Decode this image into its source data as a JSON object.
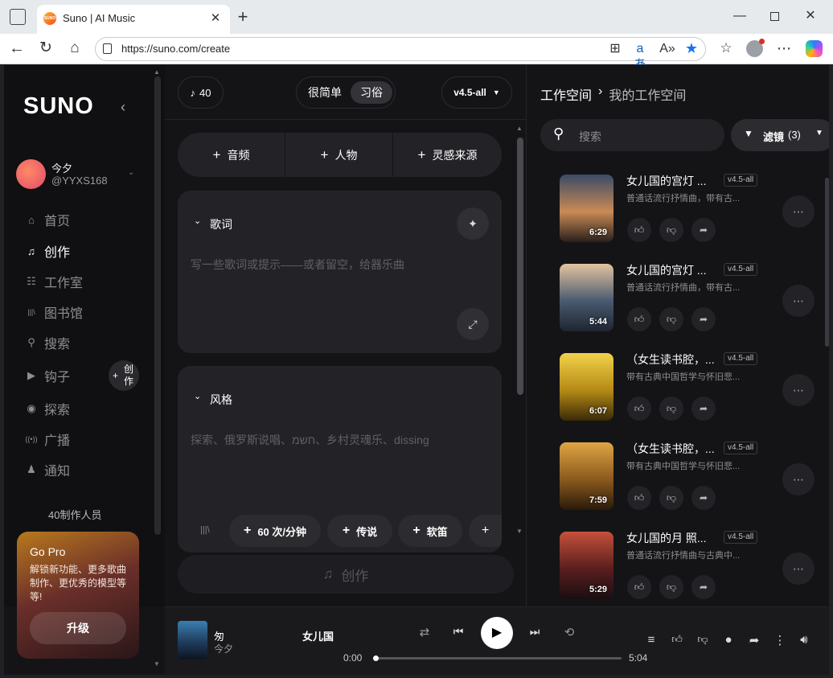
{
  "browser": {
    "tab_title": "Suno | AI Music",
    "favicon_text": "SUNO",
    "url": "https://suno.com/create"
  },
  "sidebar": {
    "logo": "SUNO",
    "user": {
      "name": "今夕",
      "handle": "@YYXS168"
    },
    "items": [
      {
        "label": "首页",
        "icon": "home-icon",
        "glyph": "⌂",
        "active": false
      },
      {
        "label": "创作",
        "icon": "music-note-icon",
        "glyph": "♫",
        "active": true
      },
      {
        "label": "工作室",
        "icon": "studio-icon",
        "glyph": "☷",
        "active": false
      },
      {
        "label": "图书馆",
        "icon": "library-icon",
        "glyph": "|||\\",
        "active": false
      },
      {
        "label": "搜索",
        "icon": "search-icon",
        "glyph": "⚲",
        "active": false
      },
      {
        "label": "钩子",
        "icon": "hook-icon",
        "glyph": "▶",
        "active": false
      },
      {
        "label": "探索",
        "icon": "compass-icon",
        "glyph": "◉",
        "active": false
      },
      {
        "label": "广播",
        "icon": "broadcast-icon",
        "glyph": "((•))",
        "active": false
      },
      {
        "label": "通知",
        "icon": "bell-icon",
        "glyph": "♟",
        "active": false
      }
    ],
    "create_chip": {
      "plus": "+",
      "line1": "创",
      "line2": "作"
    },
    "creators_label": "40制作人员",
    "gopro": {
      "title": "Go Pro",
      "text": "解锁新功能、更多歌曲制作、更优秀的模型等等!",
      "button": "升级"
    }
  },
  "create": {
    "credits": "40",
    "modes": [
      "很简单",
      "习俗"
    ],
    "active_mode": "习俗",
    "model": "v4.5-all",
    "add_buttons": [
      "音频",
      "人物",
      "灵感来源"
    ],
    "lyrics": {
      "label": "歌词",
      "placeholder": "写一些歌词或提示——或者留空，给器乐曲"
    },
    "style": {
      "label": "风格",
      "placeholder": "探索、俄罗斯说唱、חשמ、乡村灵魂乐、dissing"
    },
    "style_tags": [
      "60 次/分钟",
      "传说",
      "软笛",
      "+"
    ],
    "create_button": "创作"
  },
  "workspace": {
    "breadcrumb_root": "工作空间",
    "breadcrumb_sep": "›",
    "breadcrumb_current": "我的工作空间",
    "search_placeholder": "搜索",
    "filter_label": "滤镜",
    "filter_count": "(3)",
    "songs": [
      {
        "title": "女儿国的宫灯 ...",
        "model": "v4.5-all",
        "desc": "普通话流行抒情曲，带有古...",
        "duration": "6:29",
        "colors": [
          "#3a4a66",
          "#c98a55",
          "#2a1f1c"
        ]
      },
      {
        "title": "女儿国的宫灯 ...",
        "model": "v4.5-all",
        "desc": "普通话流行抒情曲，带有古...",
        "duration": "5:44",
        "colors": [
          "#e3c4a0",
          "#4a5a70",
          "#1e2530"
        ]
      },
      {
        "title": "（女生读书腔，...",
        "model": "v4.5-all",
        "desc": "带有古典中国哲学与怀旧悲...",
        "duration": "6:07",
        "colors": [
          "#f2d24a",
          "#b58a16",
          "#3a2a08"
        ]
      },
      {
        "title": "（女生读书腔，...",
        "model": "v4.5-all",
        "desc": "带有古典中国哲学与怀旧悲...",
        "duration": "7:59",
        "colors": [
          "#e0a544",
          "#8a5a1e",
          "#2a1a0a"
        ]
      },
      {
        "title": "女儿国的月 照...",
        "model": "v4.5-all",
        "desc": "普通话流行抒情曲与古典中...",
        "duration": "5:29",
        "colors": [
          "#c5513a",
          "#5a1e1e",
          "#1a0e10"
        ]
      }
    ]
  },
  "player": {
    "title": "匆",
    "artist": "今夕",
    "song_title": "女儿国",
    "time_current": "0:00",
    "time_total": "5:04",
    "progress": 0.0
  }
}
